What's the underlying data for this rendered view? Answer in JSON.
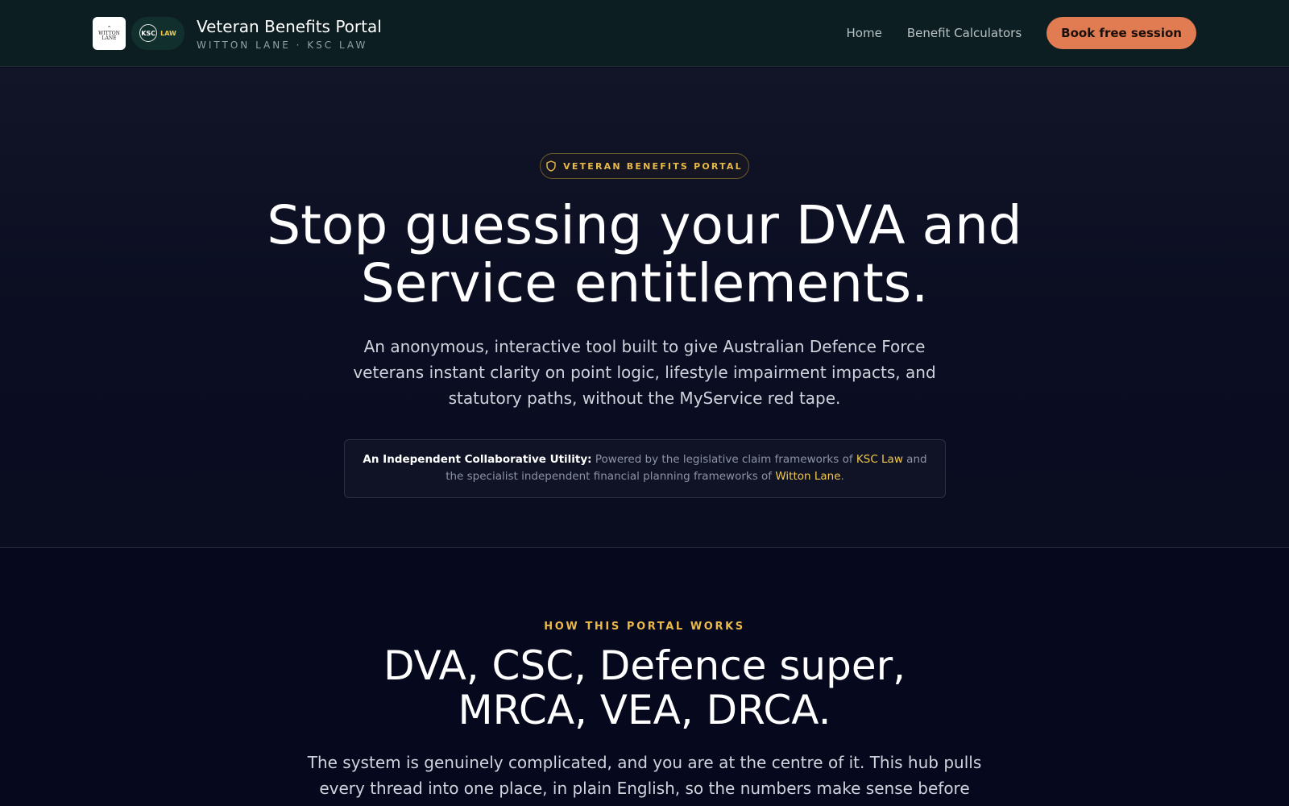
{
  "header": {
    "logo_wl_line1": "WITTON",
    "logo_wl_line2": "LANE",
    "logo_ksc_mark": "KSC",
    "logo_ksc_law": "LAW",
    "title": "Veteran Benefits Portal",
    "subtitle": "WITTON LANE · KSC LAW",
    "nav": [
      {
        "label": "Home"
      },
      {
        "label": "Benefit Calculators"
      }
    ],
    "cta_label": "Book free session"
  },
  "hero": {
    "badge": "VETERAN BENEFITS PORTAL",
    "badge_icon": "shield-icon",
    "title_line1": "Stop guessing your DVA and",
    "title_line2": "Service entitlements.",
    "lead": "An anonymous, interactive tool built to give Australian Defence Force veterans instant clarity on point logic, lifestyle impairment impacts, and statutory paths, without the MyService red tape.",
    "note": {
      "strong": "An Independent Collaborative Utility:",
      "text1": " Powered by the legislative claim frameworks of ",
      "link1": "KSC Law",
      "text2": " and the specialist independent financial planning frameworks of ",
      "link2": "Witton Lane",
      "text3": "."
    }
  },
  "how": {
    "eyebrow": "HOW THIS PORTAL WORKS",
    "title_line1": "DVA, CSC, Defence super,",
    "title_line2": "MRCA, VEA, DRCA.",
    "lead": "The system is genuinely complicated, and you are at the centre of it. This hub pulls every thread into one place, in plain English, so the numbers make sense before"
  },
  "colors": {
    "header_bg": "#0c1e21",
    "accent_gold": "#f2c94c",
    "cta_orange": "#e07b52",
    "page_bg": "#080b1f"
  }
}
